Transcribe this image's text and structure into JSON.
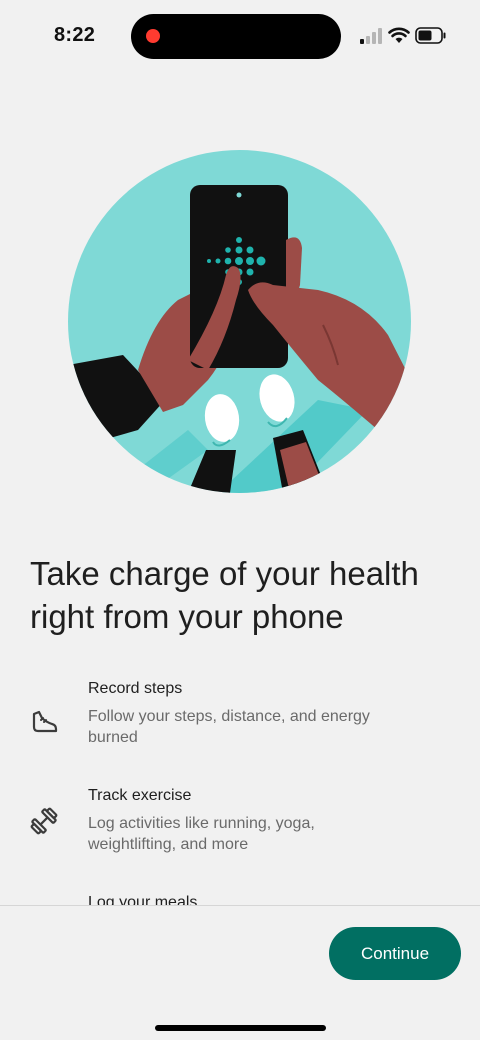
{
  "status_bar": {
    "time": "8:22",
    "icons": [
      "cellular-signal-icon",
      "wifi-icon",
      "battery-icon"
    ]
  },
  "illustration": {
    "name": "hands-holding-phone-illustration",
    "colors": {
      "circle": "#7fd9d6",
      "phone": "#111111",
      "logo_dots": "#1fb3ad",
      "skin": "#9c4c47",
      "sleeve": "#000000"
    }
  },
  "headline": "Take charge of your health right from your phone",
  "features": [
    {
      "icon": "shoe-icon",
      "title": "Record steps",
      "description": "Follow your steps, distance, and energy burned"
    },
    {
      "icon": "dumbbell-icon",
      "title": "Track exercise",
      "description": "Log activities like running, yoga, weightlifting, and more"
    },
    {
      "icon": "meal-icon",
      "title": "Log your meals",
      "description": ""
    }
  ],
  "actions": {
    "continue_label": "Continue",
    "continue_color": "#016f62"
  }
}
